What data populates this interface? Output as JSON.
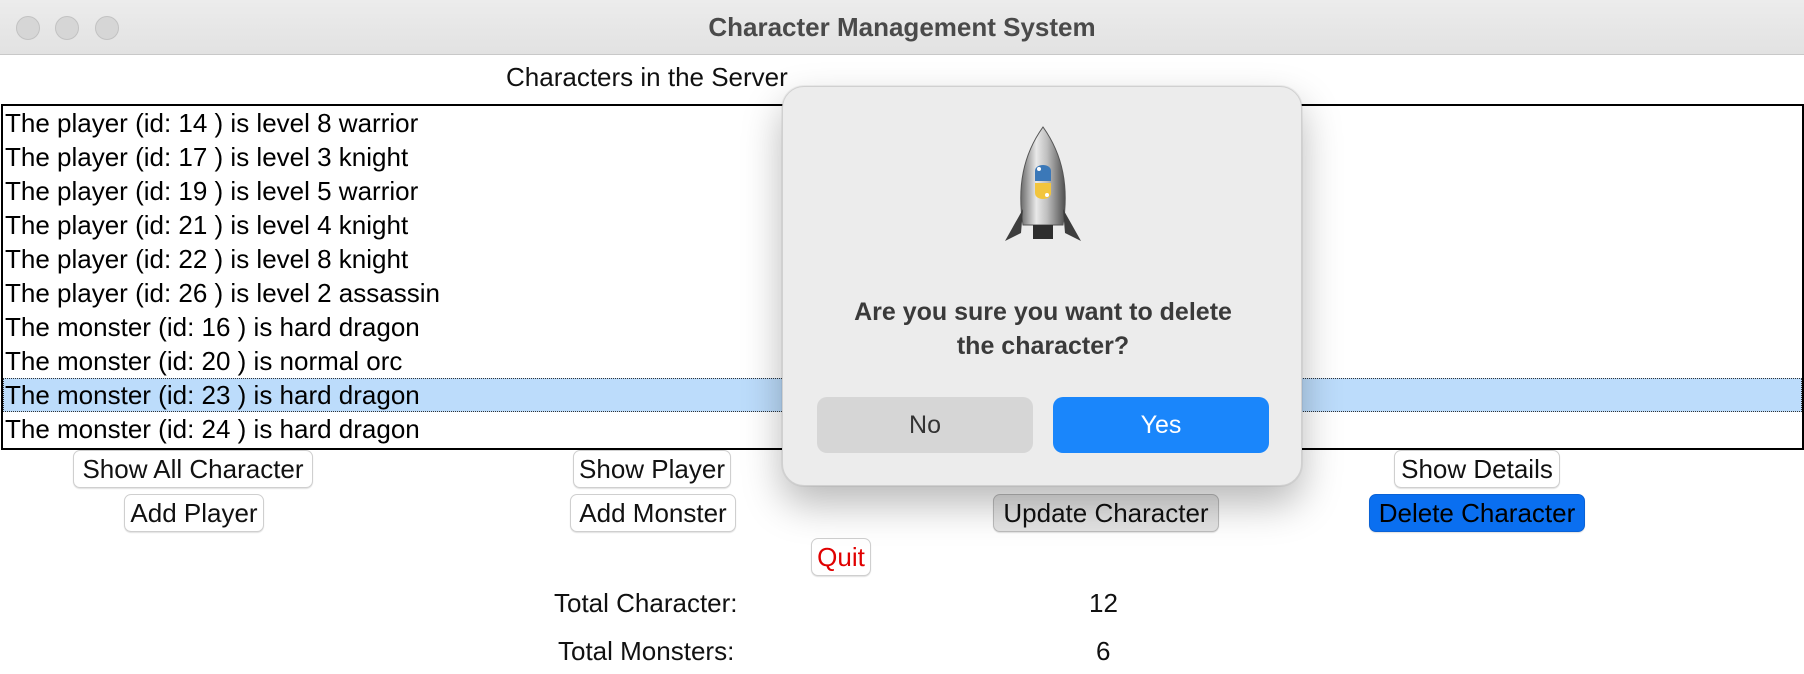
{
  "window": {
    "title": "Character Management System"
  },
  "list": {
    "heading": "Characters in the Server",
    "items": [
      "The player (id: 14 ) is level 8 warrior",
      "The player (id: 17 ) is level 3 knight",
      "The player (id: 19 ) is level 5 warrior",
      "The player (id: 21 ) is level 4 knight",
      "The player (id: 22 ) is level 8 knight",
      "The player (id: 26 ) is level 2 assassin",
      "The monster (id: 16 ) is hard dragon",
      "The monster (id: 20 ) is normal orc",
      "The monster (id: 23 ) is hard dragon",
      "The monster (id: 24 ) is hard dragon"
    ],
    "selected_index": 8
  },
  "buttons": {
    "show_all": "Show All Character",
    "show_player": "Show Player",
    "show_details": "Show Details",
    "add_player": "Add Player",
    "add_monster": "Add Monster",
    "update_character": "Update Character",
    "delete_character": "Delete Character",
    "quit": "Quit"
  },
  "stats": {
    "total_character_label": "Total Character:",
    "total_character_value": "12",
    "total_monsters_label": "Total Monsters:",
    "total_monsters_value": "6"
  },
  "dialog": {
    "message_line1": "Are you sure you want to delete",
    "message_line2": "the character?",
    "no_label": "No",
    "yes_label": "Yes",
    "icon": "python-launcher-rocket-icon"
  },
  "colors": {
    "selection": "#bcdcfb",
    "primary_button": "#0a6ff0",
    "dialog_yes": "#1a86fb",
    "quit_text": "#e00000"
  }
}
